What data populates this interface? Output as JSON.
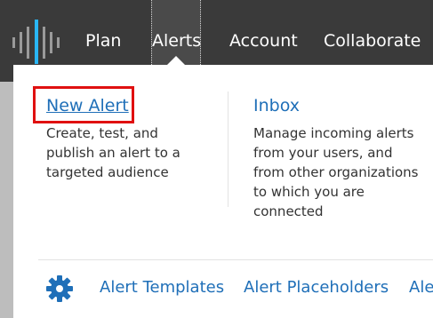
{
  "nav": {
    "plan": "Plan",
    "alerts": "Alerts",
    "account": "Account",
    "collaborate": "Collaborate"
  },
  "dropdown": {
    "new_alert": {
      "label": "New Alert",
      "description": "Create, test, and publish an alert to a targeted audience"
    },
    "inbox": {
      "label": "Inbox",
      "description": "Manage incoming alerts from your users, and from other organizations to which you are connected"
    },
    "bottom_links": {
      "templates": "Alert Templates",
      "placeholders": "Alert Placeholders",
      "more": "Ale"
    },
    "icons": {
      "settings": "gear-icon"
    }
  },
  "colors": {
    "nav_background": "#3a3a3a",
    "link": "#1f6fb8",
    "highlight": "#e01010",
    "logo_accent": "#29b6f6"
  }
}
